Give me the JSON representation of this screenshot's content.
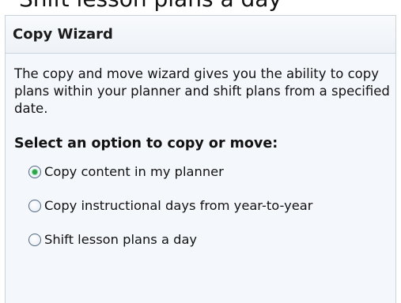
{
  "top_cut_label": "Shift lesson plans a day",
  "wizard": {
    "title": "Copy Wizard",
    "description": "The copy and move wizard gives you the ability to copy plans within your planner and shift plans from a specified date.",
    "option_heading": "Select an option to copy or move:",
    "options": [
      {
        "label": "Copy content in my planner",
        "selected": true
      },
      {
        "label": "Copy instructional days from year-to-year",
        "selected": false
      },
      {
        "label": "Shift lesson plans a day",
        "selected": false
      }
    ]
  },
  "colors": {
    "panel_background": "#f4f7fb",
    "panel_border": "#c9d4df",
    "radio_selected": "#28a745"
  }
}
